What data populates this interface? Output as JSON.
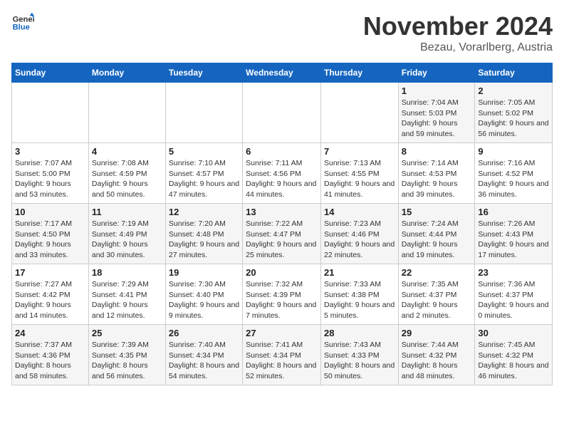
{
  "logo": {
    "line1": "General",
    "line2": "Blue"
  },
  "title": "November 2024",
  "subtitle": "Bezau, Vorarlberg, Austria",
  "days_of_week": [
    "Sunday",
    "Monday",
    "Tuesday",
    "Wednesday",
    "Thursday",
    "Friday",
    "Saturday"
  ],
  "weeks": [
    [
      {
        "day": "",
        "info": ""
      },
      {
        "day": "",
        "info": ""
      },
      {
        "day": "",
        "info": ""
      },
      {
        "day": "",
        "info": ""
      },
      {
        "day": "",
        "info": ""
      },
      {
        "day": "1",
        "info": "Sunrise: 7:04 AM\nSunset: 5:03 PM\nDaylight: 9 hours and 59 minutes."
      },
      {
        "day": "2",
        "info": "Sunrise: 7:05 AM\nSunset: 5:02 PM\nDaylight: 9 hours and 56 minutes."
      }
    ],
    [
      {
        "day": "3",
        "info": "Sunrise: 7:07 AM\nSunset: 5:00 PM\nDaylight: 9 hours and 53 minutes."
      },
      {
        "day": "4",
        "info": "Sunrise: 7:08 AM\nSunset: 4:59 PM\nDaylight: 9 hours and 50 minutes."
      },
      {
        "day": "5",
        "info": "Sunrise: 7:10 AM\nSunset: 4:57 PM\nDaylight: 9 hours and 47 minutes."
      },
      {
        "day": "6",
        "info": "Sunrise: 7:11 AM\nSunset: 4:56 PM\nDaylight: 9 hours and 44 minutes."
      },
      {
        "day": "7",
        "info": "Sunrise: 7:13 AM\nSunset: 4:55 PM\nDaylight: 9 hours and 41 minutes."
      },
      {
        "day": "8",
        "info": "Sunrise: 7:14 AM\nSunset: 4:53 PM\nDaylight: 9 hours and 39 minutes."
      },
      {
        "day": "9",
        "info": "Sunrise: 7:16 AM\nSunset: 4:52 PM\nDaylight: 9 hours and 36 minutes."
      }
    ],
    [
      {
        "day": "10",
        "info": "Sunrise: 7:17 AM\nSunset: 4:50 PM\nDaylight: 9 hours and 33 minutes."
      },
      {
        "day": "11",
        "info": "Sunrise: 7:19 AM\nSunset: 4:49 PM\nDaylight: 9 hours and 30 minutes."
      },
      {
        "day": "12",
        "info": "Sunrise: 7:20 AM\nSunset: 4:48 PM\nDaylight: 9 hours and 27 minutes."
      },
      {
        "day": "13",
        "info": "Sunrise: 7:22 AM\nSunset: 4:47 PM\nDaylight: 9 hours and 25 minutes."
      },
      {
        "day": "14",
        "info": "Sunrise: 7:23 AM\nSunset: 4:46 PM\nDaylight: 9 hours and 22 minutes."
      },
      {
        "day": "15",
        "info": "Sunrise: 7:24 AM\nSunset: 4:44 PM\nDaylight: 9 hours and 19 minutes."
      },
      {
        "day": "16",
        "info": "Sunrise: 7:26 AM\nSunset: 4:43 PM\nDaylight: 9 hours and 17 minutes."
      }
    ],
    [
      {
        "day": "17",
        "info": "Sunrise: 7:27 AM\nSunset: 4:42 PM\nDaylight: 9 hours and 14 minutes."
      },
      {
        "day": "18",
        "info": "Sunrise: 7:29 AM\nSunset: 4:41 PM\nDaylight: 9 hours and 12 minutes."
      },
      {
        "day": "19",
        "info": "Sunrise: 7:30 AM\nSunset: 4:40 PM\nDaylight: 9 hours and 9 minutes."
      },
      {
        "day": "20",
        "info": "Sunrise: 7:32 AM\nSunset: 4:39 PM\nDaylight: 9 hours and 7 minutes."
      },
      {
        "day": "21",
        "info": "Sunrise: 7:33 AM\nSunset: 4:38 PM\nDaylight: 9 hours and 5 minutes."
      },
      {
        "day": "22",
        "info": "Sunrise: 7:35 AM\nSunset: 4:37 PM\nDaylight: 9 hours and 2 minutes."
      },
      {
        "day": "23",
        "info": "Sunrise: 7:36 AM\nSunset: 4:37 PM\nDaylight: 9 hours and 0 minutes."
      }
    ],
    [
      {
        "day": "24",
        "info": "Sunrise: 7:37 AM\nSunset: 4:36 PM\nDaylight: 8 hours and 58 minutes."
      },
      {
        "day": "25",
        "info": "Sunrise: 7:39 AM\nSunset: 4:35 PM\nDaylight: 8 hours and 56 minutes."
      },
      {
        "day": "26",
        "info": "Sunrise: 7:40 AM\nSunset: 4:34 PM\nDaylight: 8 hours and 54 minutes."
      },
      {
        "day": "27",
        "info": "Sunrise: 7:41 AM\nSunset: 4:34 PM\nDaylight: 8 hours and 52 minutes."
      },
      {
        "day": "28",
        "info": "Sunrise: 7:43 AM\nSunset: 4:33 PM\nDaylight: 8 hours and 50 minutes."
      },
      {
        "day": "29",
        "info": "Sunrise: 7:44 AM\nSunset: 4:32 PM\nDaylight: 8 hours and 48 minutes."
      },
      {
        "day": "30",
        "info": "Sunrise: 7:45 AM\nSunset: 4:32 PM\nDaylight: 8 hours and 46 minutes."
      }
    ]
  ]
}
